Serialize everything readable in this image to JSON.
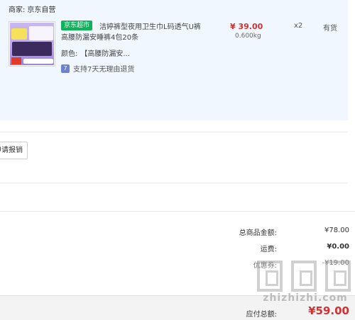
{
  "order": {
    "vendor_label": "商家:",
    "vendor_name": "京东自营",
    "item": {
      "badge": "京东超市",
      "title_line1": "洁婷裤型夜用卫生巾L码透气U裤",
      "title_line2": "高腰防漏安睡裤4包20条",
      "color_label": "颜色:",
      "color_value": "【高腰防漏安...",
      "return_icon": "7",
      "return_policy": "支持7天无理由退货",
      "price": "¥ 39.00",
      "weight": "0.600kg",
      "quantity": "x2",
      "stock": "有货"
    }
  },
  "report_button": "申请报销",
  "summary": {
    "total_label": "总商品金额:",
    "total_value": "¥78.00",
    "shipping_label": "运费:",
    "shipping_value": "¥0.00",
    "coupon_label": "优惠券:",
    "coupon_value": "-¥19.00",
    "payable_label": "应付总额:",
    "payable_value": "¥59.00"
  },
  "watermark": {
    "text": "zhizhizhi.com"
  },
  "colors": {
    "price_red": "#d23131",
    "badge_green": "#11b05a",
    "panel_bg": "#f0f7fe"
  },
  "icons": {
    "return": "seven-day-return-icon"
  }
}
